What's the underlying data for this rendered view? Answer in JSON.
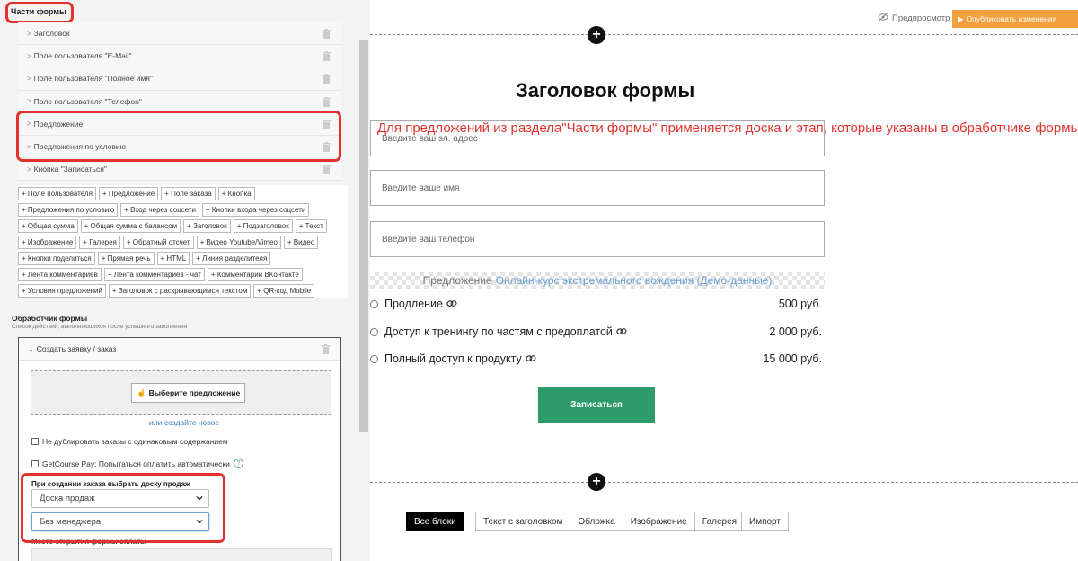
{
  "left_panel": {
    "parts_title": "Части формы",
    "parts": [
      {
        "label": "Заголовок"
      },
      {
        "label": "Поле пользователя \"E-Mail\""
      },
      {
        "label": "Поле пользователя \"Полное имя\""
      },
      {
        "label": "Поле пользователя \"Телефон\""
      },
      {
        "label": "Предложение"
      },
      {
        "label": "Предложения по условию"
      },
      {
        "label": "Кнопка \"Записаться\""
      }
    ],
    "add_buttons": [
      "+ Поле пользователя",
      "+ Предложение",
      "+ Поле заказа",
      "+ Кнопка",
      "+ Предложения по условию",
      "+ Вход через соцсети",
      "+ Кнопки входа через соцсети",
      "+ Общая сумма",
      "+ Общая сумма с балансом",
      "+ Заголовок",
      "+ Подзаголовок",
      "+ Текст",
      "+ Изображение",
      "+ Галерея",
      "+ Обратный отсчет",
      "+ Видео Youtube/Vimeo",
      "+ Видео",
      "+ Кнопки поделиться",
      "+ Прямая речь",
      "+ HTML",
      "+ Линия разделителя",
      "+ Лента комментариев",
      "+ Лента комментариев - чат",
      "+ Комментарии ВКонтакте",
      "+ Условия предложений",
      "+ Заголовок с раскрывающимся текстом",
      "+ QR-код Mobile"
    ],
    "handler": {
      "title": "Обработчик формы",
      "subtitle": "Список действий, выполняющихся после успешного заполнения",
      "action_label": "Создать заявку / заказ",
      "pick_offer_label": "Выберите предложение",
      "create_new_link": "или создайте новое",
      "no_duplicates_label": "Не дублировать заказы с одинаковым содержанием",
      "getcourse_pay_label": "GetCourse Pay: Попытаться оплатить автоматически",
      "board_label": "При создании заказа выбрать доску продаж",
      "board_select_value": "Доска продаж",
      "manager_select_value": "Без менеджера",
      "payment_form_label": "Место открытия формы оплаты"
    }
  },
  "right_panel": {
    "preview_label": "Предпросмотр",
    "publish_label": "Опубликовать изменения",
    "form_title": "Заголовок формы",
    "annotation": "Для предложений из раздела\"Части формы\" применяется доска и этап, которые указаны в обработчике формы.",
    "email_placeholder": "Введите ваш эл. адрес",
    "name_placeholder": "Введите ваше имя",
    "phone_placeholder": "Введите ваш телефон",
    "offer_prefix": "Предложение",
    "offer_course": "Онлайн-курс экстремального вождения (Демо-данные)",
    "offers": [
      {
        "name": "Продление",
        "price": "500 руб."
      },
      {
        "name": "Доступ к тренингу по частям с предоплатой",
        "price": "2 000 руб."
      },
      {
        "name": "Полный доступ к продукту",
        "price": "15 000 руб."
      }
    ],
    "submit_label": "Записаться",
    "block_tabs": [
      "Все блоки",
      "Текст с заголовком",
      "Обложка",
      "Изображение",
      "Галерея"
    ],
    "import_label": "Импорт"
  },
  "colors": {
    "highlight": "#e2322c",
    "publish": "#f2a03d",
    "submit": "#2d9c6a",
    "link": "#3a7bbf"
  }
}
